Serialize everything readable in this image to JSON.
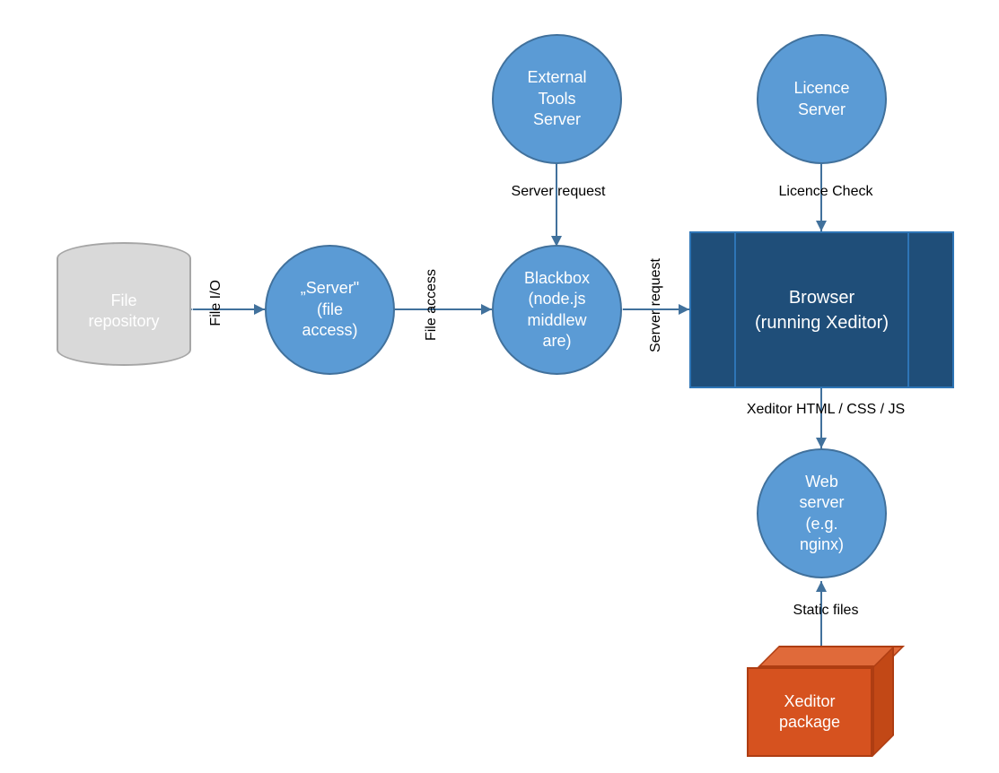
{
  "nodes": {
    "file_repo": {
      "label": "File\nrepository"
    },
    "server": {
      "label": "„Server\"\n(file\naccess)"
    },
    "blackbox": {
      "label": "Blackbox\n(node.js\nmiddlew\nare)"
    },
    "external_tools": {
      "label": "External\nTools\nServer"
    },
    "licence_server": {
      "label": "Licence\nServer"
    },
    "browser": {
      "label": "Browser\n(running Xeditor)"
    },
    "web_server": {
      "label": "Web\nserver\n(e.g.\nnginx)"
    },
    "xeditor_package": {
      "label": "Xeditor\npackage"
    }
  },
  "edges": {
    "file_io": "File I/O",
    "file_access": "File access",
    "server_request_top": "Server request",
    "server_request_right": "Server request",
    "licence_check": "Licence Check",
    "xeditor_assets": "Xeditor HTML / CSS / JS",
    "static_files": "Static files"
  }
}
